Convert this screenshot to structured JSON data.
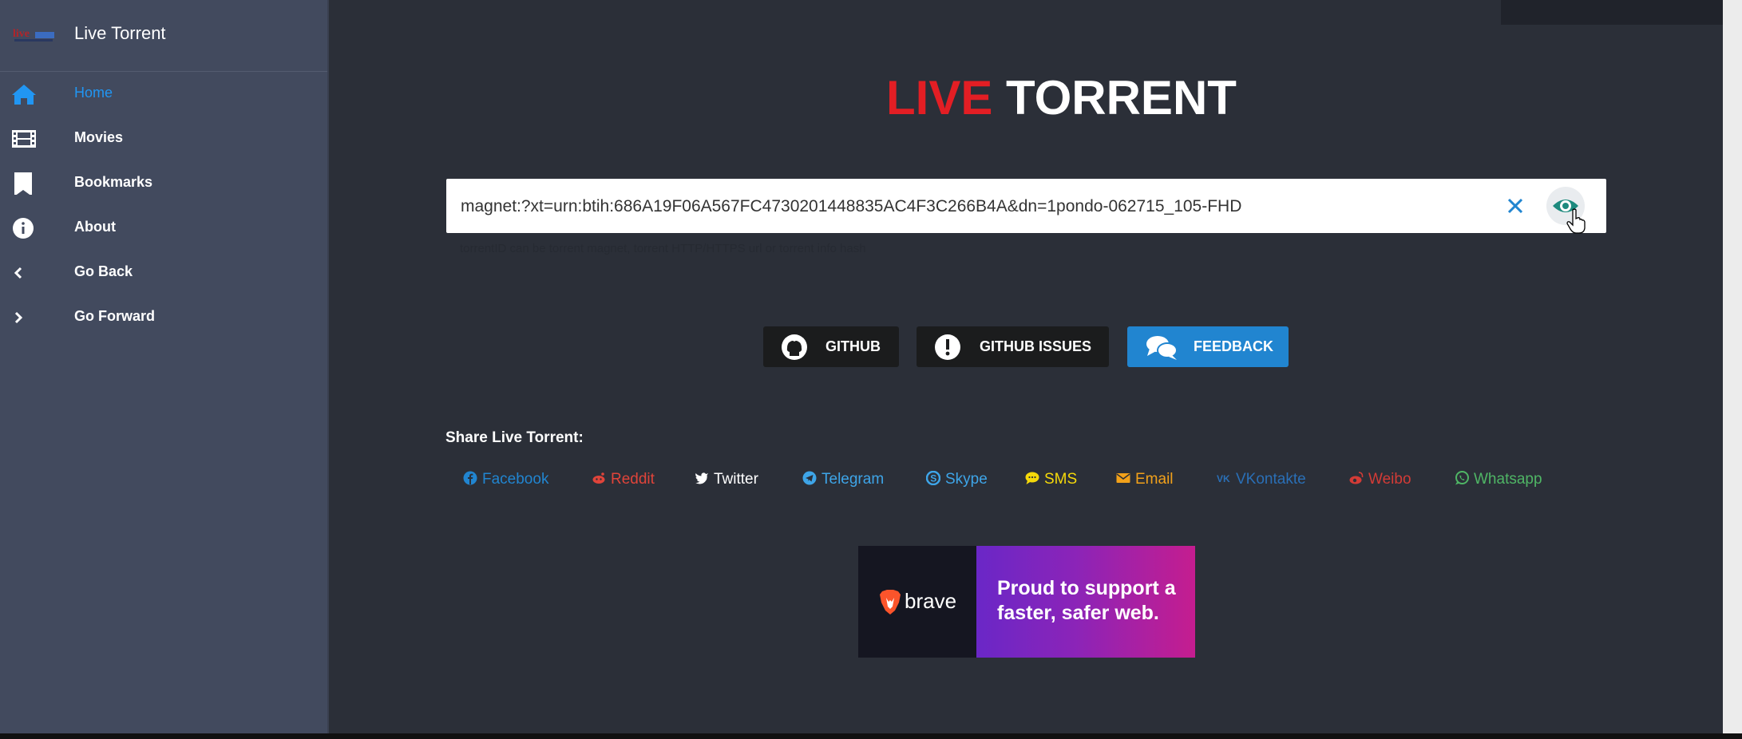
{
  "app": {
    "title": "Live Torrent"
  },
  "sidebar": {
    "items": [
      {
        "label": "Home",
        "icon": "home-icon",
        "active": true
      },
      {
        "label": "Movies",
        "icon": "film-icon"
      },
      {
        "label": "Bookmarks",
        "icon": "bookmark-icon"
      },
      {
        "label": "About",
        "icon": "info-icon"
      },
      {
        "label": "Go Back",
        "icon": "chevron-left-icon"
      },
      {
        "label": "Go Forward",
        "icon": "chevron-right-icon"
      }
    ]
  },
  "brand": {
    "live": "LIVE",
    "torrent": "TORRENT"
  },
  "search": {
    "value": "magnet:?xt=urn:btih:686A19F06A567FC4730201448835AC4F3C266B4A&dn=1pondo-062715_105-FHD",
    "hint": "torrentID can be torrent magnet, torrent HTTP/HTTPS url or torrent info hash"
  },
  "buttons": {
    "github": "GITHUB",
    "issues": "GITHUB ISSUES",
    "feedback": "FEEDBACK"
  },
  "share": {
    "title": "Share Live Torrent:",
    "links": [
      {
        "label": "Facebook",
        "color": "#2185d0",
        "icon": "facebook-icon"
      },
      {
        "label": "Reddit",
        "color": "#e0443a",
        "icon": "reddit-icon"
      },
      {
        "label": "Twitter",
        "color": "#ffffff",
        "icon": "twitter-icon"
      },
      {
        "label": "Telegram",
        "color": "#3ea5e8",
        "icon": "telegram-icon"
      },
      {
        "label": "Skype",
        "color": "#3ea5e8",
        "icon": "skype-icon"
      },
      {
        "label": "SMS",
        "color": "#f5d90a",
        "icon": "chat-icon"
      },
      {
        "label": "Email",
        "color": "#f2a11a",
        "icon": "envelope-icon"
      },
      {
        "label": "VKontakte",
        "color": "#2a6fb6",
        "icon": "vk-icon"
      },
      {
        "label": "Weibo",
        "color": "#d33b36",
        "icon": "weibo-icon"
      },
      {
        "label": "Whatsapp",
        "color": "#4fb565",
        "icon": "whatsapp-icon"
      }
    ]
  },
  "ad": {
    "brand": "brave",
    "text": "Proud to support a faster, safer web."
  },
  "colors": {
    "accent": "#2185d0",
    "brand_red": "#e31e24",
    "eye": "#1d8a7e"
  }
}
